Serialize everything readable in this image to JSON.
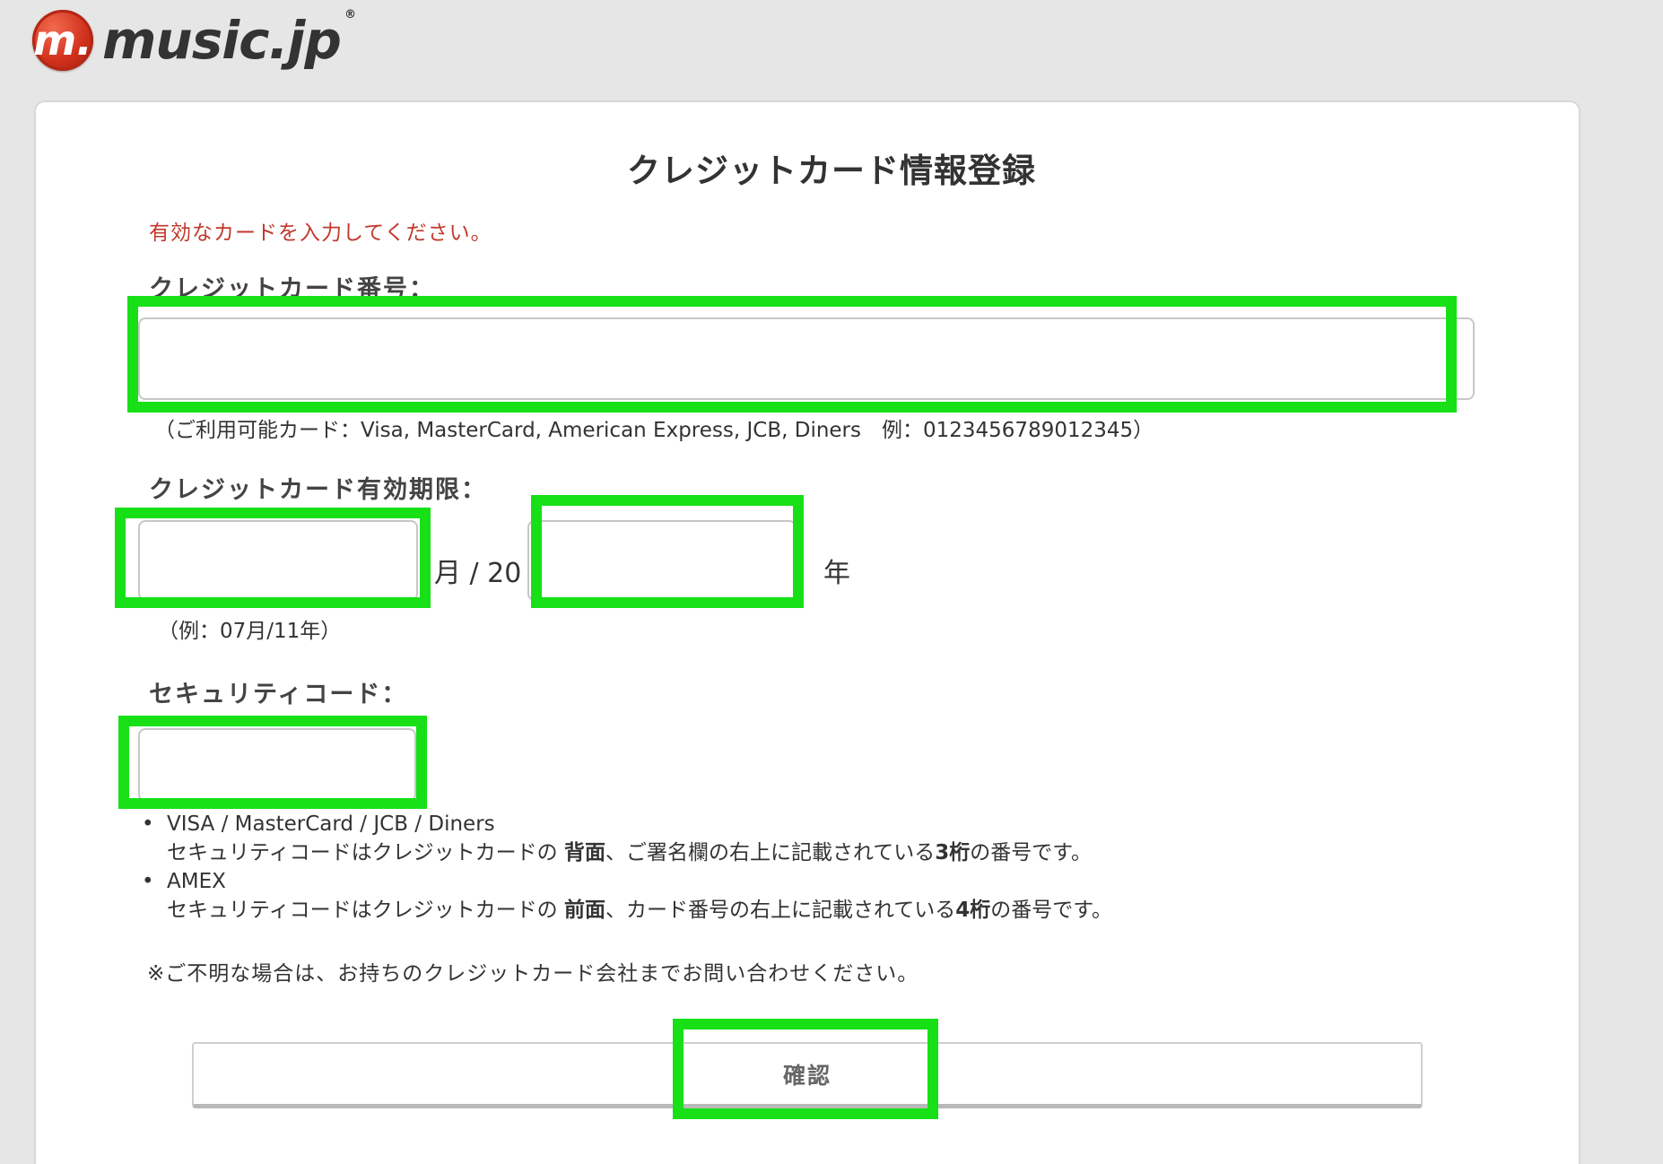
{
  "header": {
    "logo_mark": "m.",
    "logo_text": "music.jp",
    "logo_reg": "®"
  },
  "form": {
    "title": "クレジットカード情報登録",
    "error_message": "有効なカードを入力してください。",
    "card_number": {
      "label": "クレジットカード番号：",
      "value": "",
      "hint": "（ご利用可能カード：Visa, MasterCard, American Express, JCB, Diners　例：0123456789012345）"
    },
    "expiry": {
      "label": "クレジットカード有効期限：",
      "month_value": "",
      "month_suffix": "月 / 20",
      "year_value": "",
      "year_suffix": "年",
      "hint": "（例：07月/11年）"
    },
    "security_code": {
      "label": "セキュリティコード：",
      "value": ""
    },
    "security_info": [
      {
        "title": "VISA / MasterCard / JCB / Diners",
        "desc_prefix": "セキュリティコードはクレジットカードの ",
        "desc_location": "背面",
        "desc_middle": "、ご署名欄の右上に記載されている",
        "desc_digits": "3桁",
        "desc_suffix": "の番号です。"
      },
      {
        "title": "AMEX",
        "desc_prefix": "セキュリティコードはクレジットカードの ",
        "desc_location": "前面",
        "desc_middle": "、カード番号の右上に記載されている",
        "desc_digits": "4桁",
        "desc_suffix": "の番号です。"
      }
    ],
    "note": "※ご不明な場合は、お持ちのクレジットカード会社までお問い合わせください。",
    "confirm_label": "確認"
  },
  "colors": {
    "highlight": "#17e017",
    "error": "#c0392b",
    "background": "#e6e6e6"
  }
}
